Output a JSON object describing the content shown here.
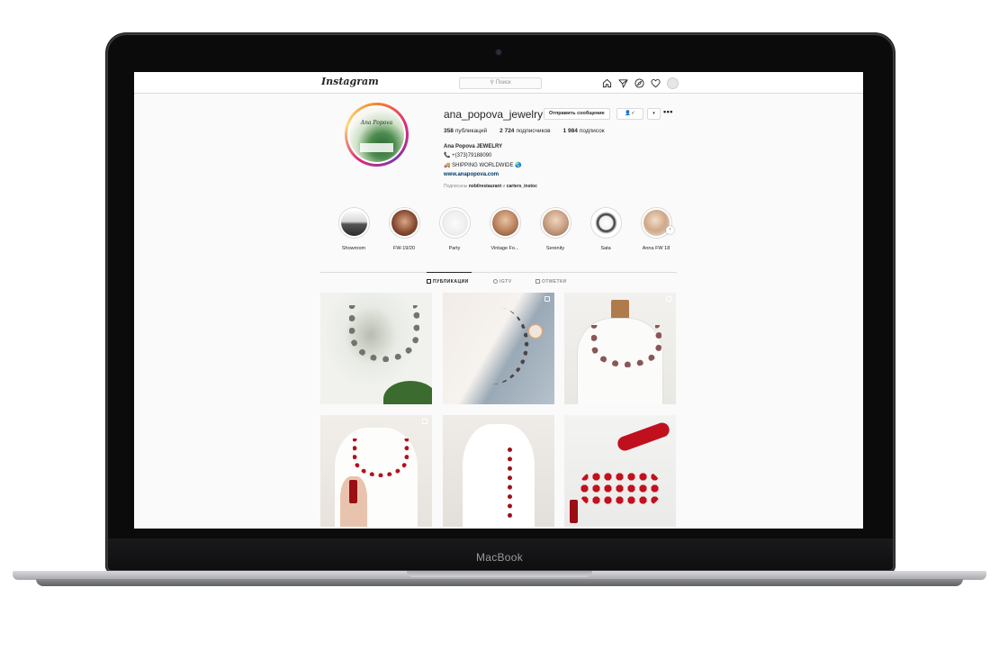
{
  "device": {
    "brand": "MacBook"
  },
  "navbar": {
    "logo": "Instagram",
    "search_placeholder": "Поиск",
    "icons": [
      "home-icon",
      "direct-icon",
      "explore-icon",
      "heart-icon",
      "profile-avatar"
    ]
  },
  "profile": {
    "username": "ana_popova_jewelry",
    "avatar_text": "Ana Popova",
    "message_button": "Отправить сообщение",
    "follow_button": "👤✓",
    "more_button": "▾",
    "options": "•••",
    "stats": {
      "posts_count": "358",
      "posts_label": "публикаций",
      "followers_count": "2 724",
      "followers_label": "подписчиков",
      "following_count": "1 984",
      "following_label": "подписок"
    },
    "bio": {
      "name": "Ana Popova JEWELRY",
      "phone": "📞 +(373)79188090",
      "shipping": "🚚 SHIPPING WORLDWIDE 🌏",
      "website": "www.anapopova.com"
    },
    "followed_by_prefix": "Подписаны",
    "followed_by_user1": "nobilrestaurant",
    "followed_by_and": "и",
    "followed_by_user2": "carters_instoc"
  },
  "highlights": [
    {
      "label": "Showroom"
    },
    {
      "label": "FW-19/20"
    },
    {
      "label": "Party"
    },
    {
      "label": "Vintage Fo..."
    },
    {
      "label": "Serenity"
    },
    {
      "label": "Sata"
    },
    {
      "label": "Anna FW 18"
    }
  ],
  "tabs": [
    {
      "label": "ПУБЛИКАЦИИ",
      "active": true
    },
    {
      "label": "IGTV",
      "active": false
    },
    {
      "label": "ОТМЕТКИ",
      "active": false
    }
  ],
  "colors": {
    "link": "#003569",
    "text": "#262626",
    "muted": "#8e8e8e",
    "border": "#dbdbdb"
  }
}
